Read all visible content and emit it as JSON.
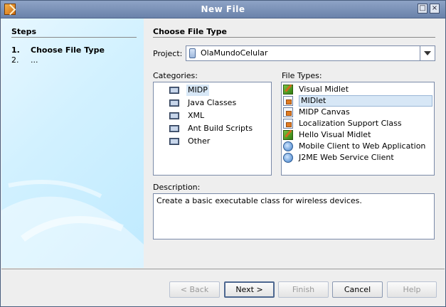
{
  "window": {
    "title": "New File",
    "controls": [
      "restore-icon",
      "close-icon"
    ]
  },
  "steps": {
    "title": "Steps",
    "items": [
      {
        "num": "1.",
        "label": "Choose File Type"
      },
      {
        "num": "2.",
        "label": "..."
      }
    ]
  },
  "main": {
    "title": "Choose File Type",
    "project_label": "Project:",
    "project_value": "OlaMundoCelular",
    "categories_label": "Categories:",
    "file_types_label": "File Types:",
    "categories": [
      "MIDP",
      "Java Classes",
      "XML",
      "Ant Build Scripts",
      "Other"
    ],
    "selected_category": "MIDP",
    "file_types": [
      {
        "label": "Visual Midlet",
        "icon": "visual-midlet-icon"
      },
      {
        "label": "MIDlet",
        "icon": "midlet-icon"
      },
      {
        "label": "MIDP Canvas",
        "icon": "midp-canvas-icon"
      },
      {
        "label": "Localization Support Class",
        "icon": "localization-class-icon"
      },
      {
        "label": "Hello Visual Midlet",
        "icon": "visual-midlet-icon"
      },
      {
        "label": "Mobile Client to Web Application",
        "icon": "web-client-icon"
      },
      {
        "label": "J2ME Web Service Client",
        "icon": "web-service-icon"
      }
    ],
    "selected_file_type": "MIDlet",
    "description_label": "Description:",
    "description_text": "Create a basic executable class for wireless devices."
  },
  "buttons": {
    "back": "< Back",
    "next": "Next >",
    "finish": "Finish",
    "cancel": "Cancel",
    "help": "Help"
  }
}
